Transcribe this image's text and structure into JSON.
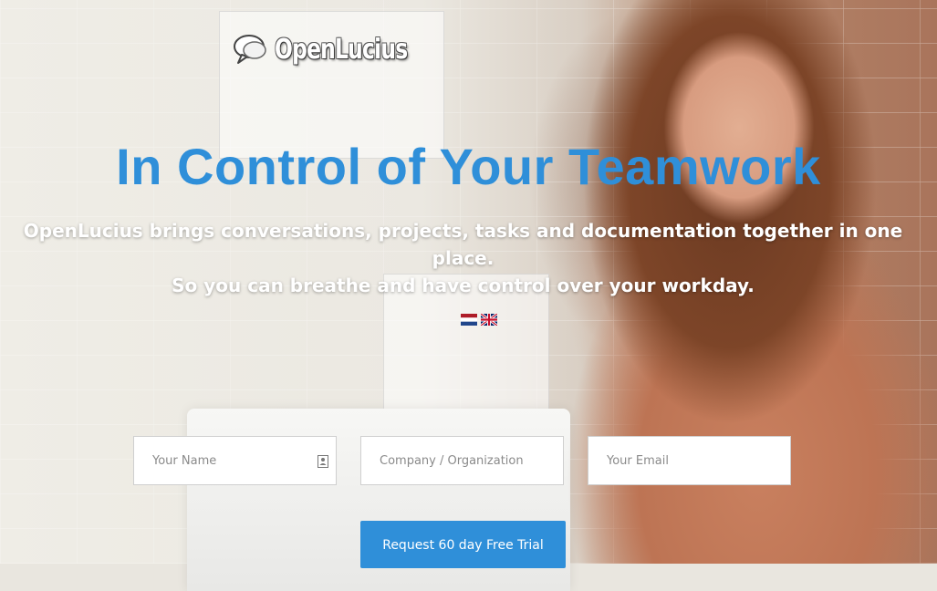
{
  "brand": {
    "name": "OpenLucius"
  },
  "hero": {
    "headline": "In Control of Your Teamwork",
    "subtitle_line1": "OpenLucius brings conversations, projects, tasks and documentation together in one place.",
    "subtitle_line2": "So you can breathe and have control over your workday."
  },
  "languages": [
    {
      "icon": "flag-netherlands-icon"
    },
    {
      "icon": "flag-uk-icon"
    }
  ],
  "form": {
    "name_placeholder": "Your Name",
    "company_placeholder": "Company / Organization",
    "email_placeholder": "Your Email",
    "submit_label": "Request 60 day Free Trial"
  },
  "colors": {
    "accent": "#2f8fd9",
    "headline": "#2f8fd9",
    "button": "#2f8fd9",
    "subtitle": "#ffffff"
  }
}
